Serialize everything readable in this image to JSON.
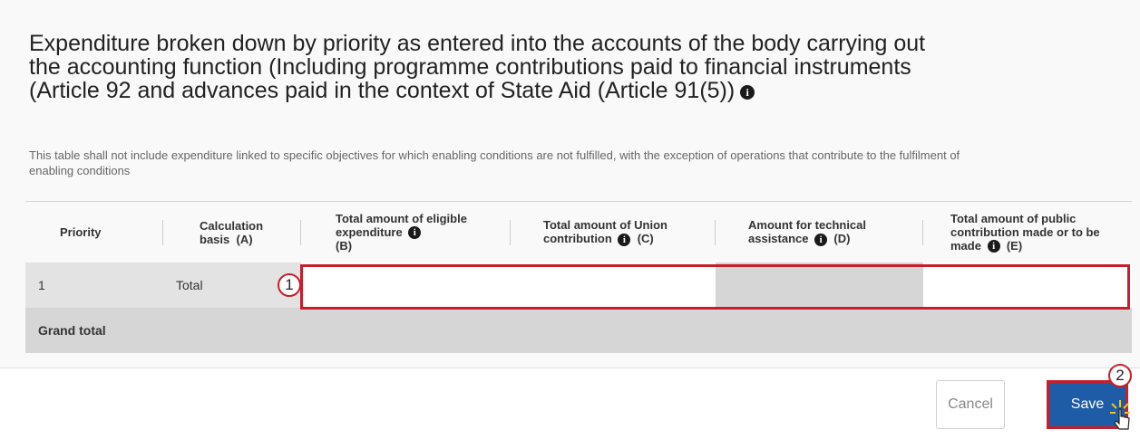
{
  "section": {
    "title": "Expenditure broken down by priority as entered into the accounts of the body carrying out the accounting function (Including programme contributions paid to financial instruments (Article 92 and advances paid in the context of State Aid (Article 91(5))",
    "info_glyph": "i",
    "subtitle": "This table shall not include expenditure linked to specific objectives for which enabling conditions are not fulfilled, with the exception of operations that contribute to the fulfilment of enabling conditions"
  },
  "table": {
    "headers": [
      {
        "label": "Priority",
        "suffix": ""
      },
      {
        "label": "Calculation basis",
        "suffix": "(A)"
      },
      {
        "label": "Total amount of eligible expenditure",
        "suffix": "(B)"
      },
      {
        "label": "Total amount of Union contribution",
        "suffix": "(C)"
      },
      {
        "label": "Amount for technical assistance",
        "suffix": "(D)"
      },
      {
        "label": "Total amount of public contribution made or to be made",
        "suffix": "(E)"
      }
    ],
    "rows": [
      {
        "priority": "1",
        "basis": "Total",
        "b": "",
        "c": "",
        "d": "",
        "e": ""
      }
    ],
    "grand_total_label": "Grand total"
  },
  "annotations": {
    "marker_1": "1",
    "marker_2": "2"
  },
  "actions": {
    "cancel_label": "Cancel",
    "save_label": "Save"
  },
  "colors": {
    "highlight": "#c91e2a",
    "save_bg": "#1f5ca8"
  }
}
